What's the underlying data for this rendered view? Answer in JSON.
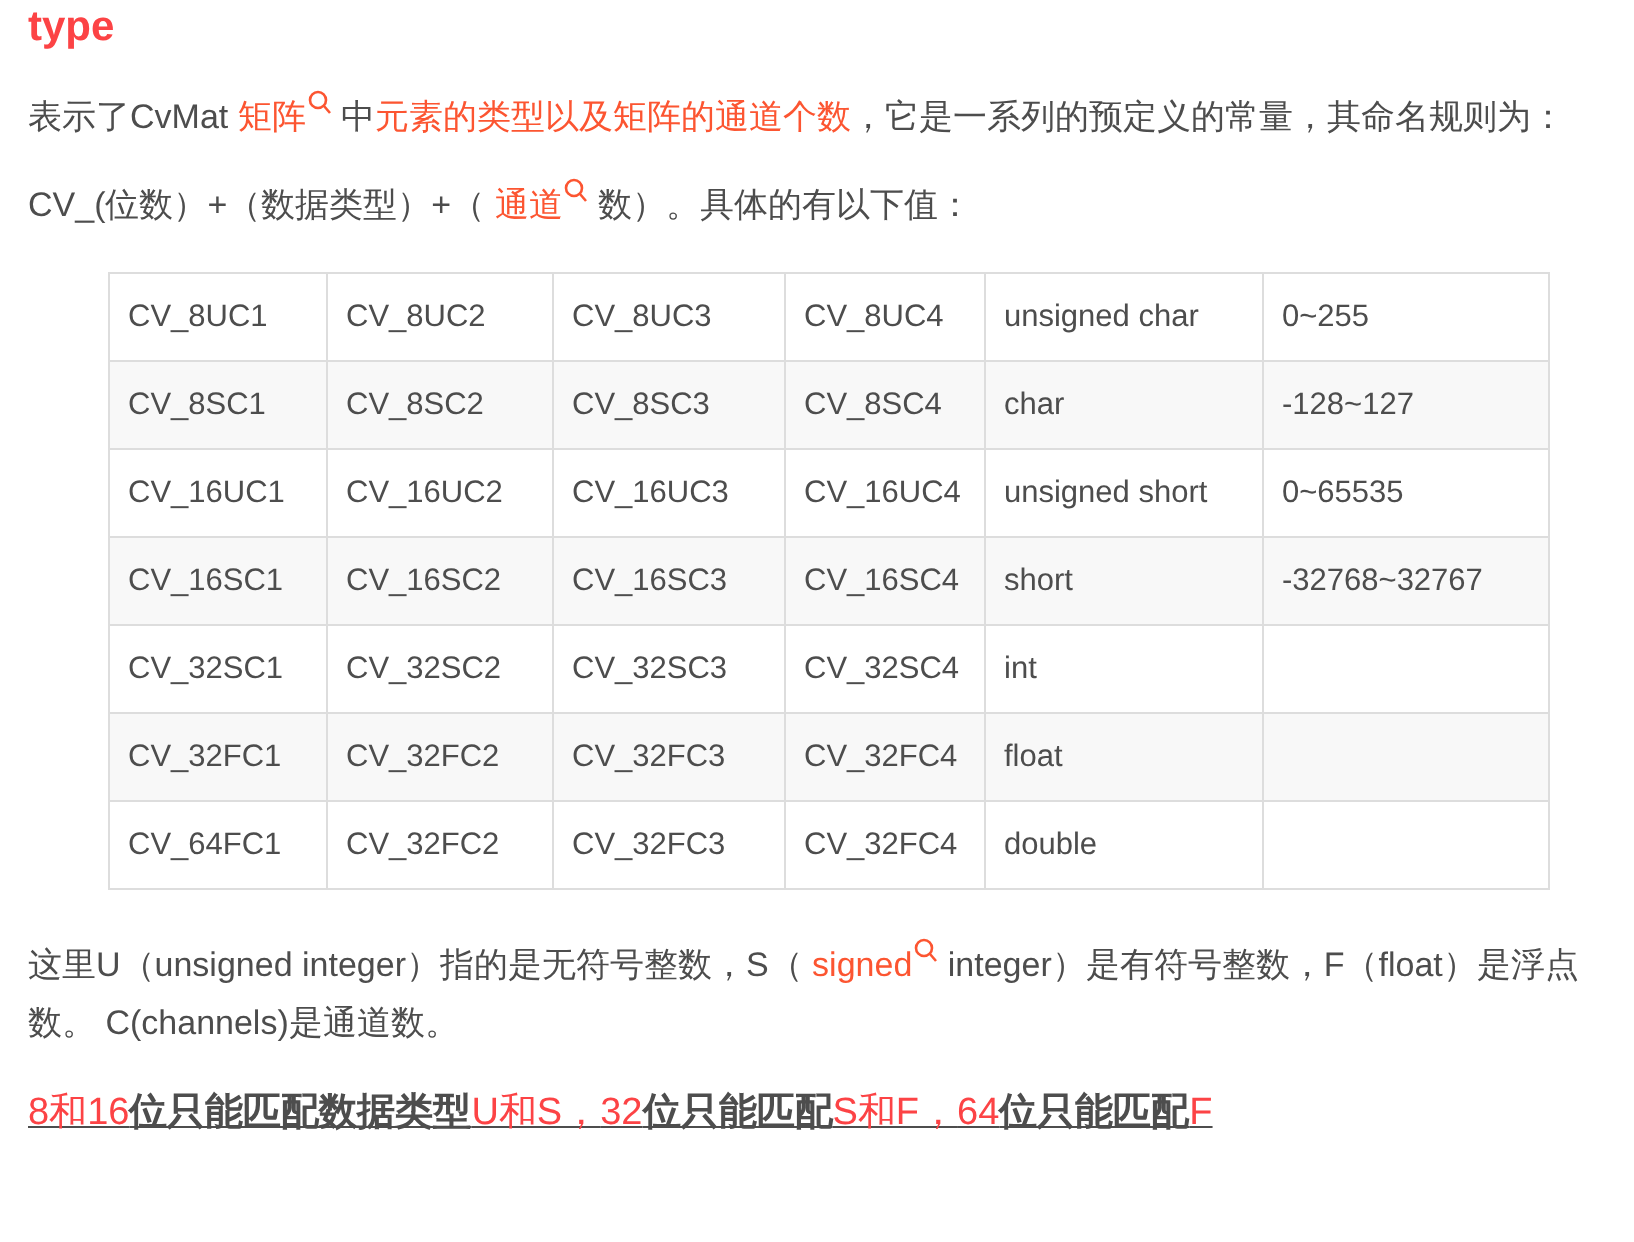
{
  "heading": "type",
  "intro": [
    {
      "kind": "plain",
      "text": "表示了CvMat "
    },
    {
      "kind": "search_link",
      "text": "矩阵"
    },
    {
      "kind": "plain",
      "text": " 中"
    },
    {
      "kind": "keyword",
      "text": "元素的类型以及矩阵的通道个数"
    },
    {
      "kind": "plain",
      "text": "，它是一系列的预定义的常量，其命名规则为："
    }
  ],
  "rule": [
    {
      "kind": "plain",
      "text": "CV_(位数）+（数据类型）+（ "
    },
    {
      "kind": "search_link",
      "text": "通道"
    },
    {
      "kind": "plain",
      "text": " 数）。具体的有以下值："
    }
  ],
  "table": {
    "rows": [
      [
        "CV_8UC1",
        "CV_8UC2",
        "CV_8UC3",
        "CV_8UC4",
        "unsigned char",
        "0~255"
      ],
      [
        "CV_8SC1",
        "CV_8SC2",
        "CV_8SC3",
        "CV_8SC4",
        "char",
        "-128~127"
      ],
      [
        "CV_16UC1",
        "CV_16UC2",
        "CV_16UC3",
        "CV_16UC4",
        "unsigned short",
        "0~65535"
      ],
      [
        "CV_16SC1",
        "CV_16SC2",
        "CV_16SC3",
        "CV_16SC4",
        "short",
        "-32768~32767"
      ],
      [
        "CV_32SC1",
        "CV_32SC2",
        "CV_32SC3",
        "CV_32SC4",
        "int",
        ""
      ],
      [
        "CV_32FC1",
        "CV_32FC2",
        "CV_32FC3",
        "CV_32FC4",
        "float",
        ""
      ],
      [
        "CV_64FC1",
        "CV_32FC2",
        "CV_32FC3",
        "CV_32FC4",
        "double",
        ""
      ]
    ]
  },
  "explanation": [
    {
      "kind": "plain",
      "text": "这里U（unsigned integer）指的是无符号整数，S（ "
    },
    {
      "kind": "search_link",
      "text": "signed"
    },
    {
      "kind": "plain",
      "text": " integer）是有符号整数，F（float）是浮点数。 C(channels)是通道数。"
    }
  ],
  "note": [
    {
      "kind": "red",
      "text": "8和16"
    },
    {
      "kind": "dark",
      "text": "位只能匹配数据类型"
    },
    {
      "kind": "red",
      "text": "U和S，"
    },
    {
      "kind": "red",
      "text": "32"
    },
    {
      "kind": "dark",
      "text": "位只能匹配"
    },
    {
      "kind": "red",
      "text": "S和F，"
    },
    {
      "kind": "red",
      "text": "64"
    },
    {
      "kind": "dark",
      "text": "位只能匹配"
    },
    {
      "kind": "red",
      "text": "F"
    }
  ]
}
